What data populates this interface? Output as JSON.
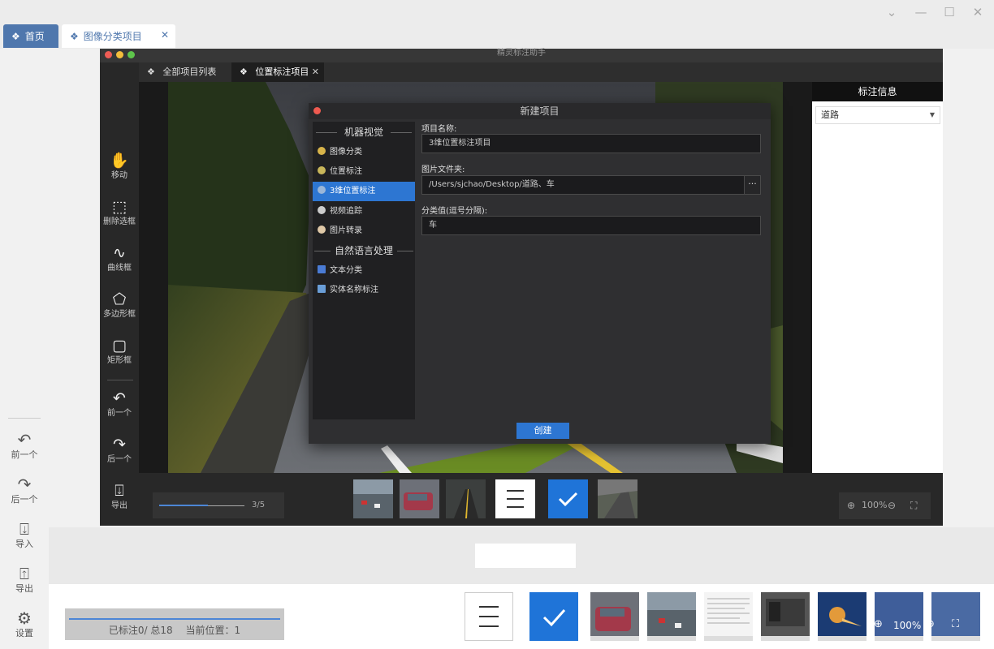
{
  "outer": {
    "tabs": [
      {
        "label": "首页",
        "icon": "diamond-grid-icon"
      },
      {
        "label": "图像分类项目",
        "icon": "diamond-grid-icon",
        "close": "✕"
      }
    ],
    "toolbar": [
      {
        "label": "前一个",
        "icon": "back-arrow-icon"
      },
      {
        "label": "后一个",
        "icon": "forward-arrow-icon"
      },
      {
        "label": "导入",
        "icon": "import-icon"
      },
      {
        "label": "导出",
        "icon": "export-icon"
      },
      {
        "label": "设置",
        "icon": "gear-icon"
      }
    ],
    "status": {
      "annotated": "已标注0/ 总18",
      "position": "当前位置：1"
    },
    "zoom": "100%",
    "accent": "#1f74d8"
  },
  "inner": {
    "title": "精灵标注助手",
    "tabs": [
      {
        "label": "全部项目列表"
      },
      {
        "label": "位置标注项目",
        "close": "✕"
      }
    ],
    "toolbar": [
      {
        "label": "移动",
        "icon": "hand-icon"
      },
      {
        "label": "删除选框",
        "icon": "delete-selection-icon"
      },
      {
        "label": "曲线框",
        "icon": "curve-icon"
      },
      {
        "label": "多边形框",
        "icon": "polygon-icon"
      },
      {
        "label": "矩形框",
        "icon": "rectangle-icon"
      },
      {
        "label": "前一个",
        "icon": "back-arrow-icon"
      },
      {
        "label": "后一个",
        "icon": "forward-arrow-icon"
      },
      {
        "label": "导出",
        "icon": "export-icon"
      }
    ],
    "progress_text": "3/5",
    "zoom": "100%",
    "annotation_panel": {
      "title": "标注信息",
      "select_value": "道路"
    }
  },
  "modal": {
    "title": "新建项目",
    "sections": [
      {
        "title": "机器视觉",
        "items": [
          "图像分类",
          "位置标注",
          "3维位置标注",
          "视频追踪",
          "图片转录"
        ]
      },
      {
        "title": "自然语言处理",
        "items": [
          "文本分类",
          "实体名称标注"
        ]
      }
    ],
    "active_item": "3维位置标注",
    "fields": [
      {
        "label": "项目名称:",
        "value": "3维位置标注项目"
      },
      {
        "label": "图片文件夹:",
        "value": "/Users/sjchao/Desktop/道路、车",
        "button": "···"
      },
      {
        "label": "分类值(逗号分隔):",
        "value": "车"
      }
    ],
    "create_button": "创建"
  }
}
